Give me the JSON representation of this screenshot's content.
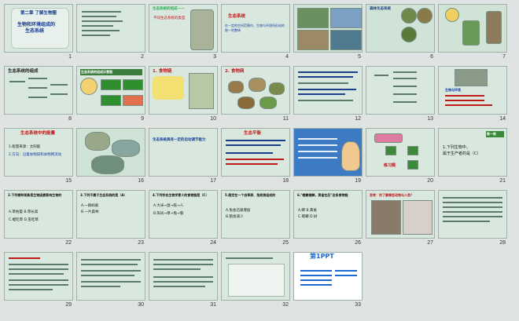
{
  "slides": [
    {
      "n": "1",
      "title": "第二章 了解生物圈",
      "sub": "生物和环境组成的",
      "sub2": "生态系统"
    },
    {
      "n": "2",
      "title": ""
    },
    {
      "n": "3",
      "title": "生态系统的组成——",
      "sub": "不同生态系统的类型"
    },
    {
      "n": "4",
      "title": "生态系统",
      "sub": "在一定的空间范围内，生物与环境所形成的统一的整体"
    },
    {
      "n": "5",
      "title": ""
    },
    {
      "n": "6",
      "title": "森林生态系统"
    },
    {
      "n": "7",
      "title": ""
    },
    {
      "n": "8",
      "title": "生态系统的组成"
    },
    {
      "n": "9",
      "title": "生态系统的组成示意图"
    },
    {
      "n": "10",
      "title": "1. 食物链"
    },
    {
      "n": "11",
      "title": "2. 食物网"
    },
    {
      "n": "12",
      "title": ""
    },
    {
      "n": "13",
      "title": ""
    },
    {
      "n": "14",
      "title": "生物与环境"
    },
    {
      "n": "15",
      "title": "生态系统中的能量",
      "sub": "1.能量来源：太阳能",
      "sub2": "2.方向：沿着食物链和食物网流动"
    },
    {
      "n": "16",
      "title": ""
    },
    {
      "n": "17",
      "title": "生态系统具有一定的自动调节能力"
    },
    {
      "n": "18",
      "title": "生态平衡"
    },
    {
      "n": "19",
      "title": ""
    },
    {
      "n": "20",
      "title": "练习题"
    },
    {
      "n": "21",
      "title": "练一练",
      "sub": "1.下列生物中，",
      "sub2": "属于生产者的是（C）"
    },
    {
      "n": "22",
      "title": "2.下列哪种现象是生物因素影响生物的",
      "sub": "A.草枯萎   B.草长高",
      "sub2": "C.蝗吃草   D.虫吃草"
    },
    {
      "n": "23",
      "title": "3.下列不属于生态系统的是（A）",
      "sub": "A.一群蚂蚁",
      "sub2": "B.一片森林"
    },
    {
      "n": "24",
      "title": "4.下列符合生物学意义的食物链是（C）",
      "sub": "A.大米→鼠→蛇→人",
      "sub2": "B.阳光→草→兔→狼"
    },
    {
      "n": "25",
      "title": "5.假定在一个由草原、兔和狼组成的",
      "sub": "A.兔会迅速增加",
      "sub2": "B.狼会减少"
    },
    {
      "n": "26",
      "title": "6.\"螳螂捕蝉，黄雀在后\"这条食物链",
      "sub": "A.蝉   B.黄雀",
      "sub2": "C.螳螂   D.树"
    },
    {
      "n": "27",
      "title": "思考：你了解哪些动物与人类？"
    },
    {
      "n": "28",
      "title": ""
    },
    {
      "n": "29",
      "title": ""
    },
    {
      "n": "30",
      "title": ""
    },
    {
      "n": "31",
      "title": ""
    },
    {
      "n": "32",
      "title": ""
    },
    {
      "n": "33",
      "title": "第1PPT"
    }
  ]
}
